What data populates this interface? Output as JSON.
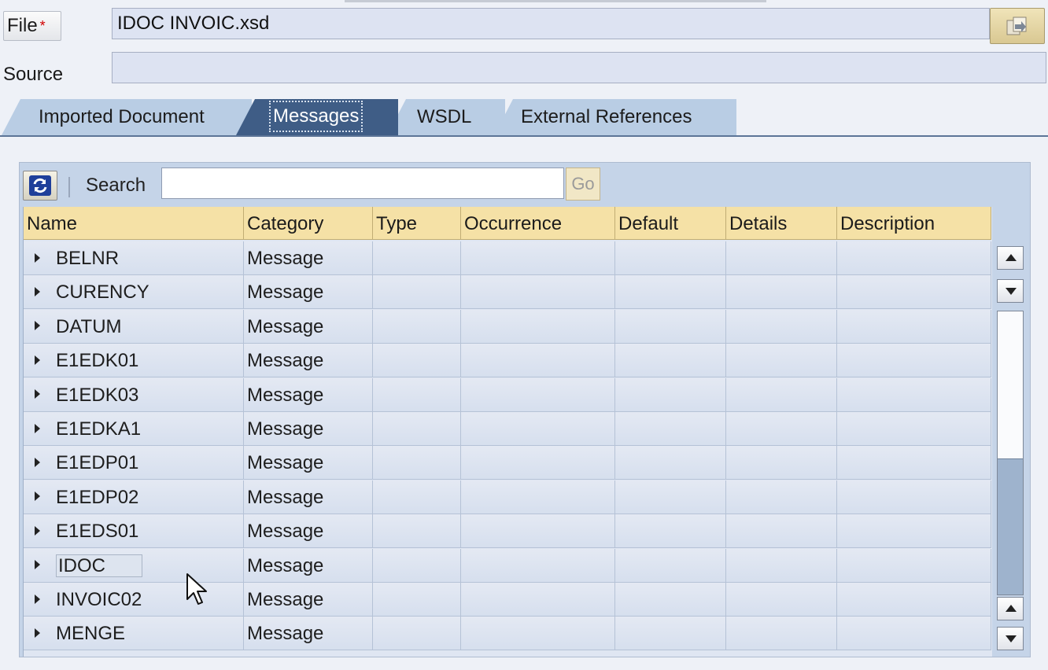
{
  "file": {
    "label": "File",
    "required_mark": "*",
    "value": "IDOC INVOIC.xsd"
  },
  "browse_icon": "browse-icon",
  "source": {
    "label": "Source",
    "value": ""
  },
  "tabs": [
    {
      "label": "Imported Document",
      "active": false
    },
    {
      "label": "Messages",
      "active": true
    },
    {
      "label": "WSDL",
      "active": false
    },
    {
      "label": "External References",
      "active": false
    }
  ],
  "toolbar": {
    "refresh_icon": "refresh-icon",
    "search_label": "Search",
    "search_value": "",
    "go_label": "Go"
  },
  "table": {
    "columns": [
      "Name",
      "Category",
      "Type",
      "Occurrence",
      "Default",
      "Details",
      "Description"
    ],
    "rows": [
      {
        "name": "BELNR",
        "category": "Message"
      },
      {
        "name": "CURENCY",
        "category": "Message"
      },
      {
        "name": "DATUM",
        "category": "Message"
      },
      {
        "name": "E1EDK01",
        "category": "Message"
      },
      {
        "name": "E1EDK03",
        "category": "Message"
      },
      {
        "name": "E1EDKA1",
        "category": "Message"
      },
      {
        "name": "E1EDP01",
        "category": "Message"
      },
      {
        "name": "E1EDP02",
        "category": "Message"
      },
      {
        "name": "E1EDS01",
        "category": "Message"
      },
      {
        "name": "IDOC",
        "category": "Message"
      },
      {
        "name": "INVOIC02",
        "category": "Message"
      },
      {
        "name": "MENGE",
        "category": "Message"
      }
    ],
    "scroll_position": 0.48
  },
  "colors": {
    "active_tab": "#3f5d86",
    "inactive_tab": "#b9cde4",
    "header": "#f5e1a6"
  }
}
